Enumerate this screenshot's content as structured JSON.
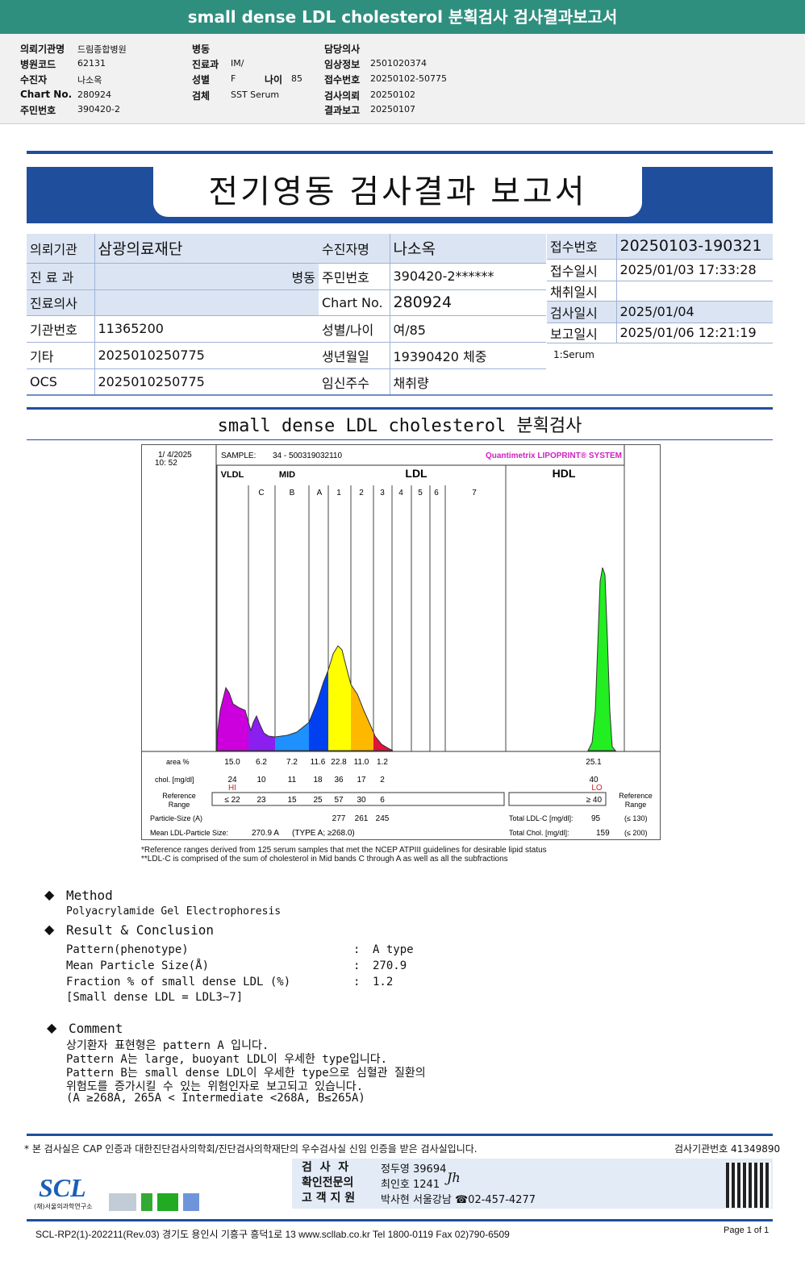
{
  "top_title": "small dense LDL cholesterol 분획검사 검사결과보고서",
  "info": {
    "col1": [
      [
        "의뢰기관명",
        "드림종합병원"
      ],
      [
        "병원코드",
        "62131"
      ],
      [
        "수진자",
        "나소옥"
      ],
      [
        "Chart No.",
        "280924"
      ],
      [
        "주민번호",
        "390420-2"
      ]
    ],
    "col2": [
      [
        "병동",
        ""
      ],
      [
        "진료과",
        "IM/"
      ],
      [
        "성별",
        "F"
      ],
      [
        "검체",
        "SST Serum"
      ]
    ],
    "age_label": "나이",
    "age": "85",
    "col3": [
      [
        "담당의사",
        ""
      ],
      [
        "임상정보",
        "2501020374"
      ],
      [
        "접수번호",
        "20250102-50775"
      ],
      [
        "검사의뢰",
        "20250102"
      ],
      [
        "결과보고",
        "20250107"
      ]
    ]
  },
  "report_title": "전기영동 검사결과 보고서",
  "table": {
    "l": [
      [
        "의뢰기관",
        "삼광의료재단"
      ],
      [
        "진 료 과",
        "병동"
      ],
      [
        "진료의사",
        ""
      ],
      [
        "기관번호",
        "11365200"
      ],
      [
        "기타",
        "2025010250775"
      ],
      [
        "OCS",
        "2025010250775"
      ]
    ],
    "m": [
      [
        "수진자명",
        "나소옥"
      ],
      [
        "주민번호",
        "390420-2******"
      ],
      [
        "Chart No.",
        "280924"
      ],
      [
        "성별/나이",
        "여/85"
      ],
      [
        "생년월일",
        "19390420 체중"
      ],
      [
        "임신주수",
        "채취량"
      ]
    ],
    "r": [
      [
        "접수번호",
        "20250103-190321"
      ],
      [
        "접수일시",
        "2025/01/03 17:33:28"
      ],
      [
        "채취일시",
        ""
      ],
      [
        "검사일시",
        "2025/01/04"
      ],
      [
        "보고일시",
        "2025/01/06 12:21:19"
      ]
    ],
    "specimen": "1:Serum"
  },
  "section_title": "small dense LDL cholesterol 분획검사",
  "chart_data": {
    "type": "area",
    "date": "1/ 4/2025",
    "time": "10: 52",
    "sample_label": "SAMPLE:",
    "sample": "34 - 500319032110",
    "brand": "Quantimetrix LIPOPRINT® SYSTEM",
    "groups": [
      "VLDL",
      "MID",
      "LDL",
      "HDL"
    ],
    "bands": [
      "C",
      "B",
      "A",
      "1",
      "2",
      "3",
      "4",
      "5",
      "6",
      "7"
    ],
    "row_labels": {
      "area": "area %",
      "chol": "chol. [mg/dl]",
      "ref": "Reference Range",
      "ref2": "Reference Range",
      "psize": "Particle-Size (A)",
      "mean": "Mean LDL-Particle Size:"
    },
    "fractions": [
      "VLDL",
      "MID-C",
      "MID-B",
      "MID-A",
      "LDL1",
      "LDL2",
      "LDL3",
      "HDL"
    ],
    "area_pct": [
      15.0,
      6.2,
      7.2,
      11.6,
      22.8,
      11.0,
      1.2,
      25.1
    ],
    "chol": [
      24,
      10,
      11,
      18,
      36,
      17,
      2,
      40
    ],
    "flags": {
      "VLDL": "HI",
      "HDL": "LO"
    },
    "reference": [
      "≤ 22",
      "23",
      "15",
      "25",
      "57",
      "30",
      "6",
      "≥ 40"
    ],
    "particle_size": [
      "277",
      "261",
      "245"
    ],
    "mean_size": "270.9 A",
    "mean_type": "(TYPE A; ≥268.0)",
    "total_ldl_label": "Total LDL-C [mg/dl]:",
    "total_ldl": "95",
    "total_ldl_ref": "(≤ 130)",
    "total_chol_label": "Total Chol. [mg/dl]:",
    "total_chol": "159",
    "total_chol_ref": "(≤ 200)",
    "colors": [
      "#cc00dd",
      "#8a1ff0",
      "#1e90ff",
      "#0040f0",
      "#ffff00",
      "#ffb800",
      "#e0143c",
      "#22ee22"
    ]
  },
  "notes": [
    "*Reference ranges derived from 125 serum samples that met the NCEP ATPIII guidelines for desirable lipid status",
    "**LDL-C is comprised of the sum of cholesterol in Mid bands C through A as well as all the subfractions"
  ],
  "method": {
    "title": "Method",
    "text": "Polyacrylamide Gel Electrophoresis"
  },
  "result": {
    "title": "Result & Conclusion",
    "rows": [
      [
        "Pattern(phenotype)",
        ":",
        "A type"
      ],
      [
        "Mean Particle Size(Å)",
        ":",
        "270.9"
      ],
      [
        "Fraction % of small dense LDL (%)",
        ":",
        "1.2"
      ]
    ],
    "note": "[Small dense LDL = LDL3~7]"
  },
  "comment": {
    "title": "Comment",
    "lines": [
      "상기환자 표현형은 pattern A 입니다.",
      "Pattern A는 large, buoyant LDL이 우세한 type입니다.",
      "Pattern B는 small dense LDL이 우세한 type으로 심혈관 질환의",
      "위험도를 증가시킬 수 있는 위험인자로 보고되고 있습니다.",
      "(A ≥268A, 265A < Intermediate <268A, B≤265A)"
    ]
  },
  "footer": {
    "cert": "* 본 검사실은 CAP 인증과 대한진단검사의학회/진단검사의학재단의 우수검사실 신임 인증을 받은 검사실입니다.",
    "lab_no": "검사기관번호 41349890",
    "staff": [
      [
        "검  사  자",
        "정두영 39694"
      ],
      [
        "확인전문의",
        "최인호 1241"
      ],
      [
        "고 객 지 원",
        "박사현 서울강남 ☎02-457-4277"
      ]
    ],
    "logo": "SCL",
    "logo_sub": "(재)서울의과학연구소",
    "address": "SCL-RP2(1)-202211(Rev.03)  경기도 용인시 기흥구 흥덕1로 13  www.scllab.co.kr  Tel 1800-0119   Fax 02)790-6509",
    "page": "Page 1 of 1"
  }
}
